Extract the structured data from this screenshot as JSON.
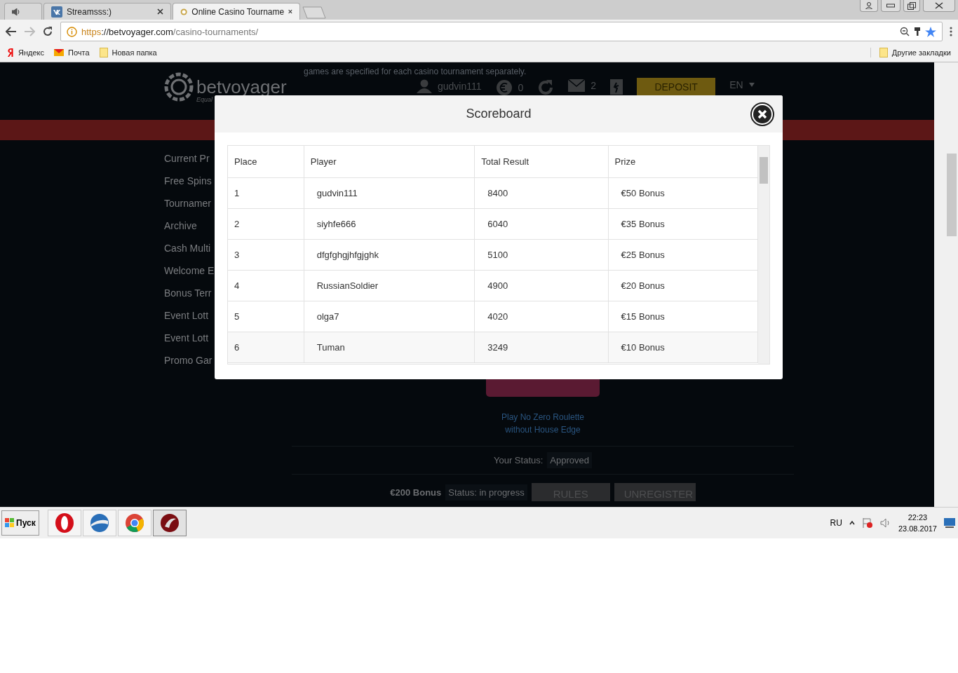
{
  "browser": {
    "tabs": [
      {
        "kind": "audio",
        "selected": false
      },
      {
        "kind": "page",
        "title": "Streamsss:)",
        "selected": false
      },
      {
        "kind": "page",
        "title": "Online Casino Tourname",
        "selected": true
      }
    ],
    "address": {
      "scheme": "https",
      "host": "://betvoyager.com",
      "path": "/casino-tournaments/"
    },
    "bookmarks": [
      {
        "kind": "yandex",
        "label": "Яндекс"
      },
      {
        "kind": "mail",
        "label": "Почта"
      },
      {
        "kind": "folder",
        "label": "Новая папка"
      }
    ],
    "other_bookmarks": "Другие закладки"
  },
  "site": {
    "logo": "betvoyager",
    "tagline": "Equal",
    "notice": "games are specified for each casino tournament separately.",
    "user": "gudvin111",
    "balance": "0",
    "messages": "2",
    "deposit": "DEPOSIT",
    "language": "EN",
    "sidebar": [
      "Current Pr",
      "Free Spins",
      "Tournamer",
      "Archive",
      "Cash Multi",
      "Welcome E",
      "Bonus Terr",
      "Event Lott",
      "Event Lott",
      "Promo Gar"
    ],
    "promo": [
      "Play No Zero Roulette",
      "without House Edge"
    ],
    "status_label": "Your Status:",
    "status_value": "Approved",
    "bonus": "€200 Bonus",
    "bonus_status": "Status: in progress",
    "buttons": [
      "RULES",
      "UNREGISTER"
    ]
  },
  "modal": {
    "title": "Scoreboard",
    "columns": [
      "Place",
      "Player",
      "Total Result",
      "Prize"
    ],
    "rows": [
      [
        "1",
        "gudvin111",
        "8400",
        "€50 Bonus"
      ],
      [
        "2",
        "siyhfe666",
        "6040",
        "€35 Bonus"
      ],
      [
        "3",
        "dfgfghgjhfgjghk",
        "5100",
        "€25 Bonus"
      ],
      [
        "4",
        "RussianSoldier",
        "4900",
        "€20 Bonus"
      ],
      [
        "5",
        "olga7",
        "4020",
        "€15 Bonus"
      ],
      [
        "6",
        "Tuman",
        "3249",
        "€10 Bonus"
      ]
    ]
  },
  "taskbar": {
    "start": "Пуск",
    "apps": [
      {
        "kind": "opera",
        "selected": false
      },
      {
        "kind": "globe",
        "selected": false
      },
      {
        "kind": "chrome",
        "selected": false
      },
      {
        "kind": "comodo",
        "selected": true
      }
    ],
    "language": "RU",
    "time": "22:23",
    "date": "23.08.2017"
  }
}
